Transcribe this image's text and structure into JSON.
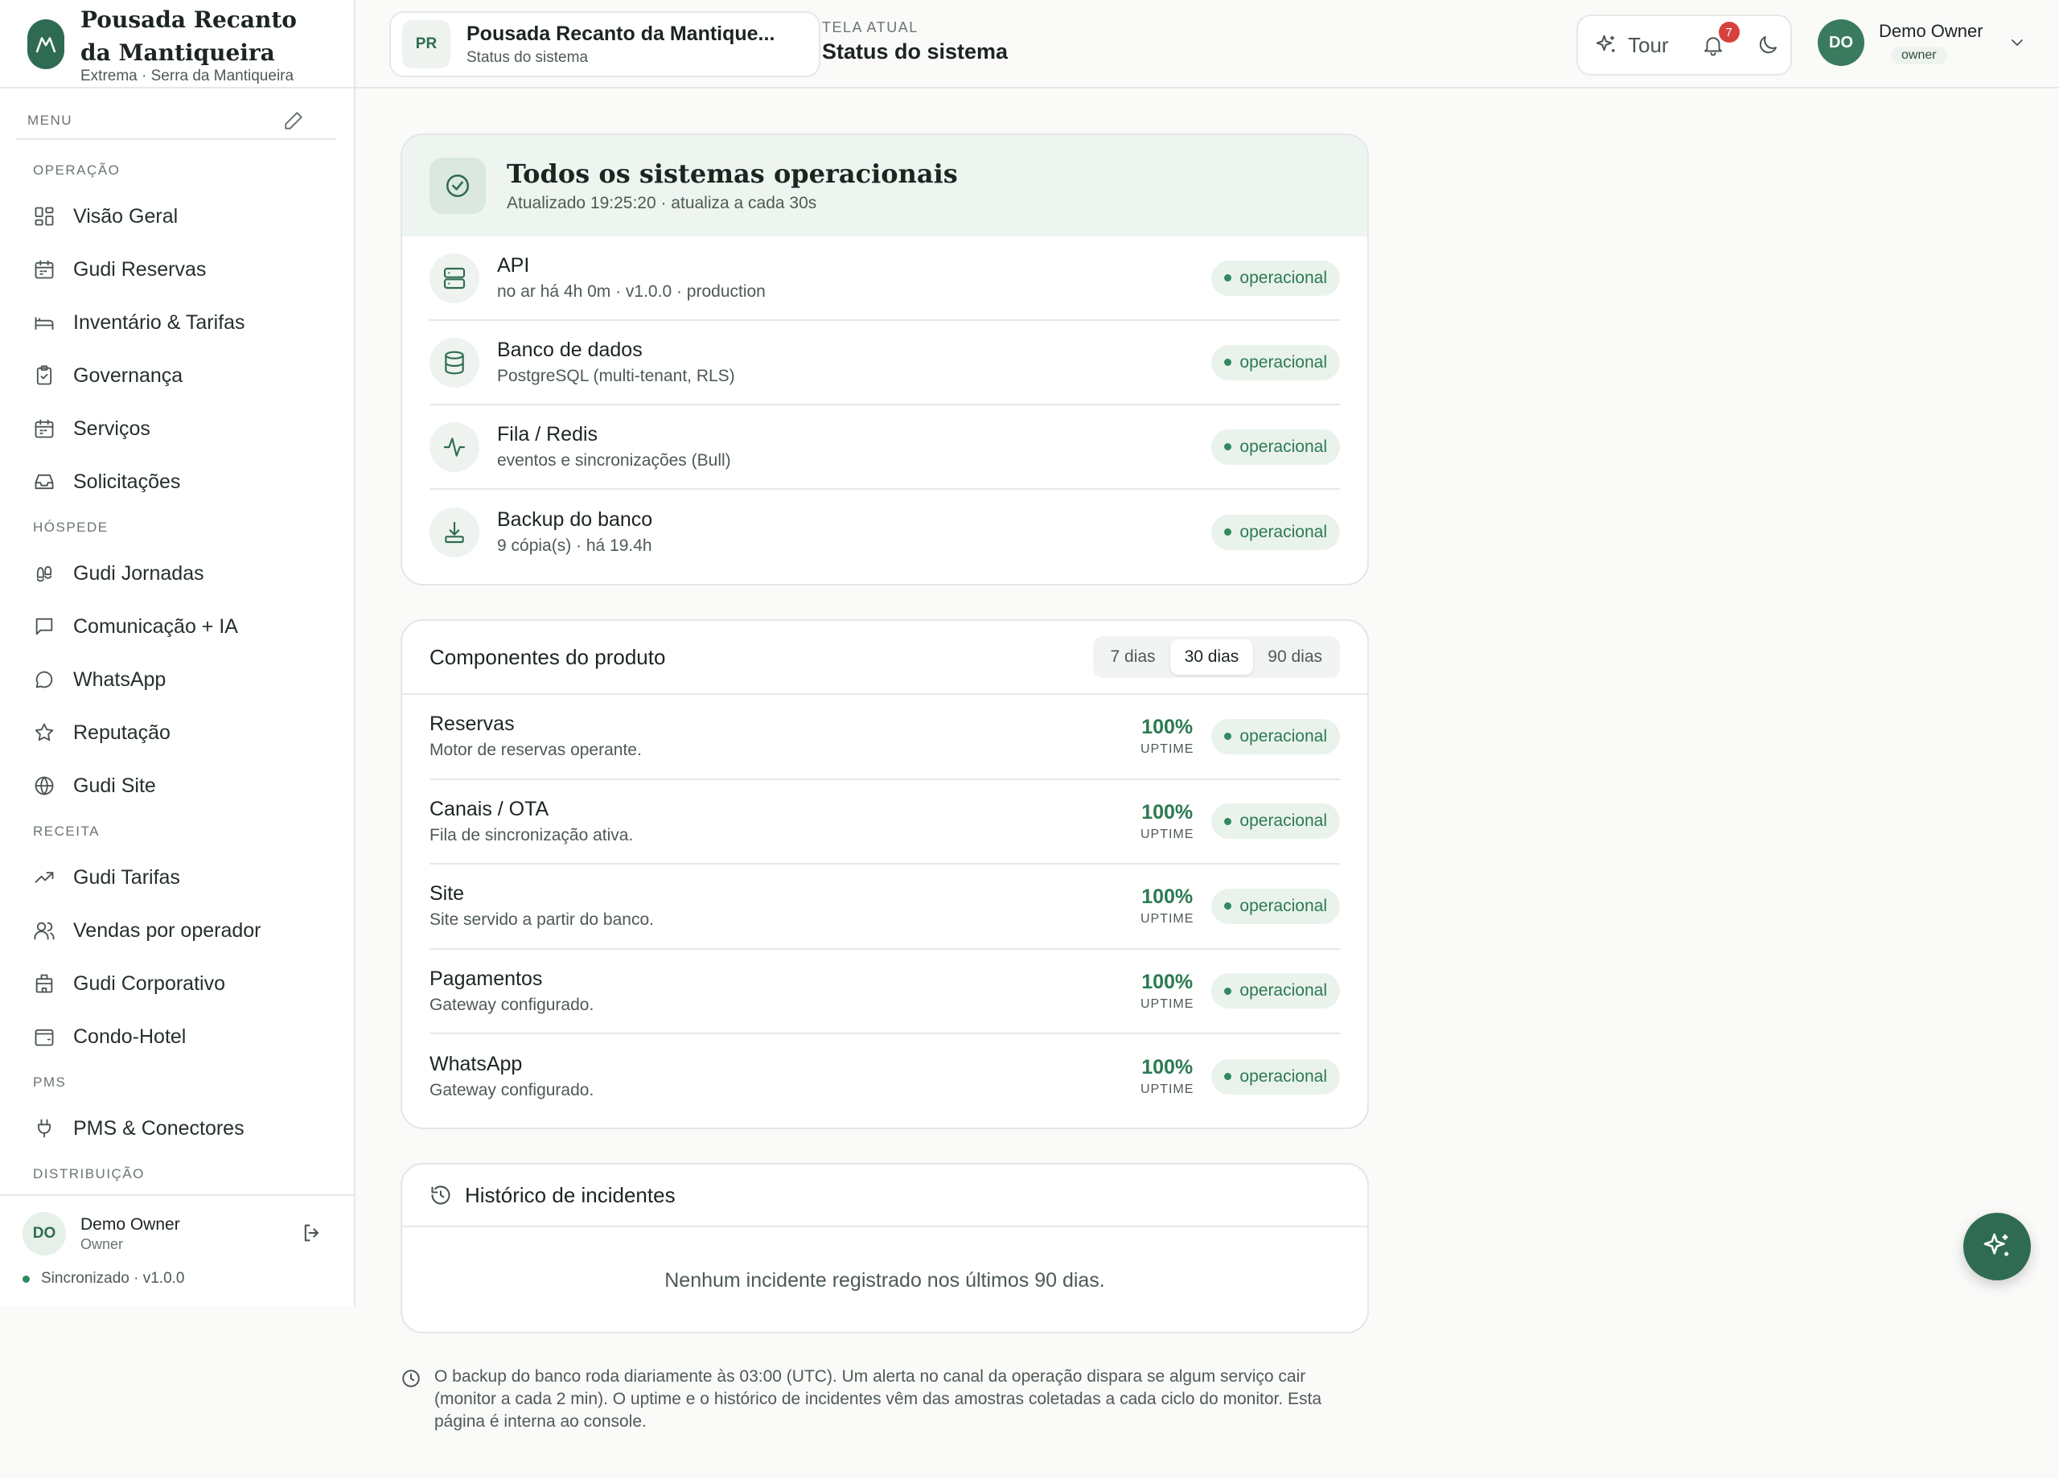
{
  "brand": {
    "name": "Pousada Recanto da Mantiqueira",
    "location": "Extrema · Serra da Mantiqueira"
  },
  "menu": {
    "label": "MENU",
    "sections": [
      {
        "title": "OPERAÇÃO",
        "items": [
          {
            "label": "Visão Geral",
            "icon": "grid-icon"
          },
          {
            "label": "Gudi Reservas",
            "icon": "calendar-icon"
          },
          {
            "label": "Inventário & Tarifas",
            "icon": "bed-icon"
          },
          {
            "label": "Governança",
            "icon": "clipboard-check-icon"
          },
          {
            "label": "Serviços",
            "icon": "calendar-icon"
          },
          {
            "label": "Solicitações",
            "icon": "inbox-icon"
          }
        ]
      },
      {
        "title": "HÓSPEDE",
        "items": [
          {
            "label": "Gudi Jornadas",
            "icon": "footprints-icon"
          },
          {
            "label": "Comunicação + IA",
            "icon": "message-square-icon"
          },
          {
            "label": "WhatsApp",
            "icon": "message-circle-icon"
          },
          {
            "label": "Reputação",
            "icon": "star-icon"
          },
          {
            "label": "Gudi Site",
            "icon": "globe-icon"
          }
        ]
      },
      {
        "title": "RECEITA",
        "items": [
          {
            "label": "Gudi Tarifas",
            "icon": "trending-up-icon"
          },
          {
            "label": "Vendas por operador",
            "icon": "users-icon"
          },
          {
            "label": "Gudi Corporativo",
            "icon": "building-icon"
          },
          {
            "label": "Condo-Hotel",
            "icon": "wallet-icon"
          }
        ]
      },
      {
        "title": "PMS",
        "items": [
          {
            "label": "PMS & Conectores",
            "icon": "plug-icon"
          }
        ]
      },
      {
        "title": "DISTRIBUIÇÃO",
        "items": []
      }
    ]
  },
  "sidebar_footer": {
    "initials": "DO",
    "name": "Demo Owner",
    "role": "Owner",
    "sync": "Sincronizado · v1.0.0"
  },
  "topbar": {
    "property_initials": "PR",
    "property_name": "Pousada Recanto da Mantique...",
    "property_sub": "Status do sistema",
    "screen_label": "TELA ATUAL",
    "screen_title": "Status do sistema",
    "tour_label": "Tour",
    "notifications": "7",
    "user_initials": "DO",
    "user_name": "Demo Owner",
    "user_role": "owner"
  },
  "status": {
    "title": "Todos os sistemas operacionais",
    "subtitle": "Atualizado 19:25:20 · atualiza a cada 30s",
    "services": [
      {
        "name": "API",
        "detail": "no ar há 4h 0m · v1.0.0 · production",
        "status": "operacional",
        "icon": "server-icon"
      },
      {
        "name": "Banco de dados",
        "detail": "PostgreSQL (multi-tenant, RLS)",
        "status": "operacional",
        "icon": "database-icon"
      },
      {
        "name": "Fila / Redis",
        "detail": "eventos e sincronizações (Bull)",
        "status": "operacional",
        "icon": "activity-icon"
      },
      {
        "name": "Backup do banco",
        "detail": "9 cópia(s) · há 19.4h",
        "status": "operacional",
        "icon": "download-icon"
      }
    ]
  },
  "components": {
    "title": "Componentes do produto",
    "ranges": [
      "7 dias",
      "30 dias",
      "90 dias"
    ],
    "active_range": "30 dias",
    "uptime_label": "UPTIME",
    "items": [
      {
        "name": "Reservas",
        "detail": "Motor de reservas operante.",
        "uptime": "100%",
        "status": "operacional"
      },
      {
        "name": "Canais / OTA",
        "detail": "Fila de sincronização ativa.",
        "uptime": "100%",
        "status": "operacional"
      },
      {
        "name": "Site",
        "detail": "Site servido a partir do banco.",
        "uptime": "100%",
        "status": "operacional"
      },
      {
        "name": "Pagamentos",
        "detail": "Gateway configurado.",
        "uptime": "100%",
        "status": "operacional"
      },
      {
        "name": "WhatsApp",
        "detail": "Gateway configurado.",
        "uptime": "100%",
        "status": "operacional"
      }
    ]
  },
  "incidents": {
    "title": "Histórico de incidentes",
    "empty": "Nenhum incidente registrado nos últimos 90 dias."
  },
  "footnote": "O backup do banco roda diariamente às 03:00 (UTC). Um alerta no canal da operação dispara se algum serviço cair (monitor a cada 2 min). O uptime e o histórico de incidentes vêm das amostras coletadas a cada ciclo do monitor. Esta página é interna ao console.",
  "colors": {
    "accent": "#2f6b53",
    "success": "#2b7a52",
    "success_bg": "#eaf2ec",
    "badge": "#d6413d"
  }
}
